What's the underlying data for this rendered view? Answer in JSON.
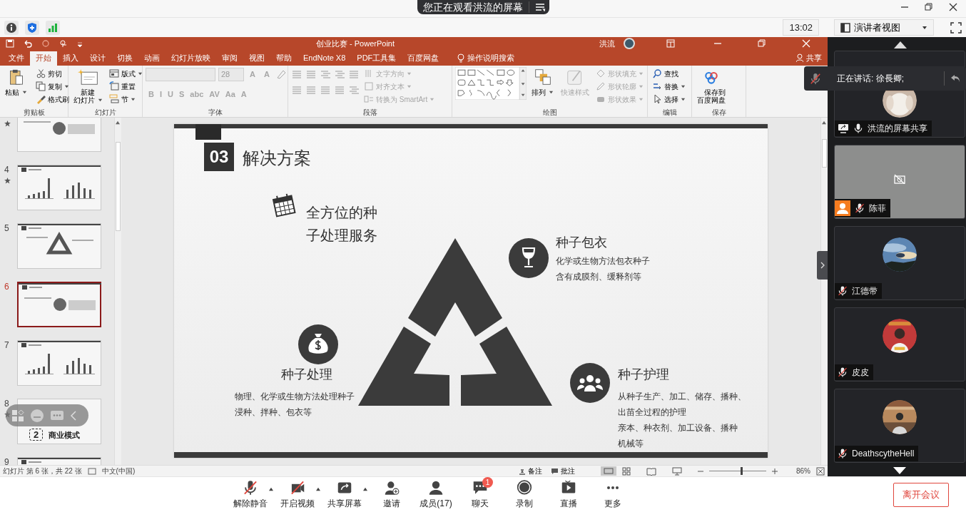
{
  "meeting": {
    "banner": "您正在观看洪流的屏幕",
    "time": "13:02",
    "view_menu": "演讲者视图"
  },
  "ppt": {
    "title": "创业比赛  -  PowerPoint",
    "user": "洪流",
    "tabs": [
      {
        "label": "文件",
        "selected": false
      },
      {
        "label": "开始",
        "selected": true
      },
      {
        "label": "插入",
        "selected": false
      },
      {
        "label": "设计",
        "selected": false
      },
      {
        "label": "切换",
        "selected": false
      },
      {
        "label": "动画",
        "selected": false
      },
      {
        "label": "幻灯片放映",
        "selected": false
      },
      {
        "label": "审阅",
        "selected": false
      },
      {
        "label": "视图",
        "selected": false
      },
      {
        "label": "帮助",
        "selected": false
      },
      {
        "label": "EndNote X8",
        "selected": false
      },
      {
        "label": "PDF工具集",
        "selected": false
      },
      {
        "label": "百度网盘",
        "selected": false
      }
    ],
    "tell_me": "操作说明搜索",
    "share": "共享",
    "ribbon": [
      {
        "kind": "clipboard",
        "label": "剪贴板",
        "items": [
          {
            "label": "粘贴",
            "disabled": false
          },
          {
            "label": "剪切",
            "disabled": false
          },
          {
            "label": "复制",
            "disabled": false
          },
          {
            "label": "格式刷",
            "disabled": false
          }
        ]
      },
      {
        "kind": "slides",
        "label": "幻灯片",
        "items": [
          {
            "label": "新建幻灯片",
            "disabled": false
          },
          {
            "label": "版式",
            "disabled": false
          },
          {
            "label": "重置",
            "disabled": false
          },
          {
            "label": "节",
            "disabled": false
          }
        ]
      },
      {
        "kind": "font",
        "label": "字体",
        "disabled": true,
        "size": "28",
        "row1_buttons": [
          "A",
          "A"
        ],
        "row2_buttons": [
          "B",
          "I",
          "U",
          "S",
          "abc",
          "AV",
          "Aa",
          "A"
        ]
      },
      {
        "kind": "paragraph",
        "label": "段落",
        "items": [
          {
            "label": "文字方向",
            "disabled": true
          },
          {
            "label": "对齐文本",
            "disabled": true
          },
          {
            "label": "转换为 SmartArt",
            "disabled": true
          }
        ]
      },
      {
        "kind": "drawing",
        "label": "绘图",
        "items": [
          {
            "label": "排列",
            "disabled": false
          },
          {
            "label": "快速样式",
            "disabled": true
          },
          {
            "label": "形状填充",
            "disabled": true
          },
          {
            "label": "形状轮廓",
            "disabled": true
          },
          {
            "label": "形状效果",
            "disabled": true
          }
        ]
      },
      {
        "kind": "editing",
        "label": "编辑",
        "items": [
          {
            "label": "查找",
            "disabled": false
          },
          {
            "label": "替换",
            "disabled": false
          },
          {
            "label": "选择",
            "disabled": false
          }
        ]
      },
      {
        "kind": "save",
        "label": "保存",
        "items": [
          {
            "label": "保存到百度网盘",
            "disabled": false
          }
        ]
      }
    ],
    "thumbnails": [
      {
        "starred": true,
        "selected": false
      },
      {
        "number": "4",
        "starred": true,
        "selected": false
      },
      {
        "number": "5",
        "starred": false,
        "selected": false
      },
      {
        "number": "6",
        "starred": false,
        "selected": true
      },
      {
        "number": "7",
        "starred": false,
        "selected": false
      },
      {
        "number": "8",
        "starred": true,
        "selected": false,
        "texts": [
          "2",
          "商业模式"
        ]
      },
      {
        "number": "9",
        "starred": false,
        "selected": false
      }
    ],
    "slide": {
      "number": "03",
      "title": "解决方案",
      "headline": "全方位的种子处理服务",
      "features": [
        {
          "kind": "coating",
          "title": "种子包衣",
          "lines": [
            "化学或生物方法包衣种子",
            "含有成膜剂、缓释剂等"
          ]
        },
        {
          "kind": "treatment",
          "title": "种子处理",
          "lines": [
            "物理、化学或生物方法处理种子",
            "浸种、拌种、包衣等"
          ]
        },
        {
          "kind": "care",
          "title": "种子护理",
          "lines": [
            "从种子生产、加工、储存、播种、",
            "出苗全过程的护理",
            "亲本、种衣剂、加工设备、播种",
            "机械等"
          ]
        }
      ]
    },
    "status_bar": {
      "slide_info": "幻灯片 第 6 张，共 22 张",
      "language": "中文(中国)",
      "notes": "备注",
      "comments": "批注",
      "zoom": {
        "level": 0.55,
        "reading": "86%"
      }
    }
  },
  "participants": {
    "speaking": "正在讲话: 徐長卿;",
    "tiles": [
      {
        "kind": "picture",
        "name": "洪流的屏幕共享",
        "muted": false,
        "sharing": true
      },
      {
        "kind": "video_off",
        "name": "陈菲",
        "muted": true,
        "sharing": false
      },
      {
        "kind": "picture",
        "name": "江德带",
        "muted": true,
        "sharing": false
      },
      {
        "kind": "picture",
        "name": "皮皮",
        "muted": true,
        "sharing": false
      },
      {
        "kind": "picture",
        "name": "DeathscytheHell",
        "muted": true,
        "sharing": false
      }
    ]
  },
  "toolbar": {
    "buttons": [
      {
        "kind": "mic",
        "label": "解除静音",
        "off": true,
        "menu": true
      },
      {
        "kind": "video",
        "label": "开启视频",
        "off": true,
        "menu": true
      },
      {
        "kind": "share",
        "label": "共享屏幕",
        "off": false,
        "menu": true
      },
      {
        "kind": "invite",
        "label": "邀请",
        "off": false,
        "menu": false
      },
      {
        "kind": "members",
        "label": "成员(17)",
        "off": false,
        "menu": false
      },
      {
        "kind": "chat",
        "label": "聊天",
        "off": false,
        "menu": false,
        "badge": "1"
      },
      {
        "kind": "record",
        "label": "录制",
        "off": false,
        "menu": false
      },
      {
        "kind": "live",
        "label": "直播",
        "off": false,
        "menu": false
      },
      {
        "kind": "more",
        "label": "更多",
        "off": false,
        "menu": false
      }
    ],
    "leave": "离开会议"
  }
}
